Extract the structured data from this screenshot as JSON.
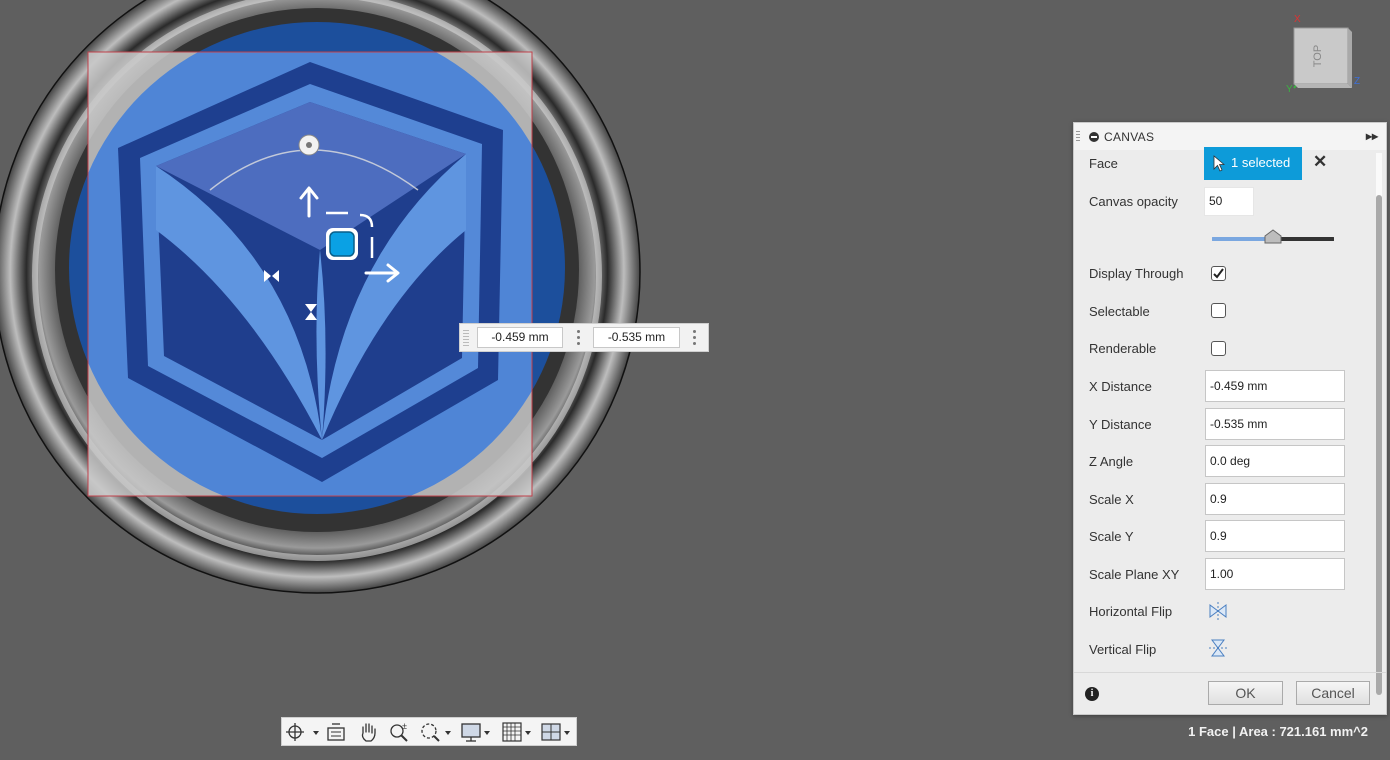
{
  "viewcube": {
    "face_label": "TOP",
    "axes": {
      "x": "X",
      "y": "Y",
      "z": "Z"
    }
  },
  "floating_inputs": {
    "x_value": "-0.459 mm",
    "y_value": "-0.535 mm"
  },
  "dialog": {
    "title": "CANVAS",
    "face": {
      "label": "Face",
      "selection_label": "1 selected",
      "clear_symbol": "✕"
    },
    "canvas_opacity": {
      "label": "Canvas opacity",
      "value": "50",
      "slider_fraction": 0.5
    },
    "display_through": {
      "label": "Display Through",
      "checked": true
    },
    "selectable": {
      "label": "Selectable",
      "checked": false
    },
    "renderable": {
      "label": "Renderable",
      "checked": false
    },
    "x_distance": {
      "label": "X Distance",
      "value": "-0.459 mm"
    },
    "y_distance": {
      "label": "Y Distance",
      "value": "-0.535 mm"
    },
    "z_angle": {
      "label": "Z Angle",
      "value": "0.0 deg"
    },
    "scale_x": {
      "label": "Scale X",
      "value": "0.9"
    },
    "scale_y": {
      "label": "Scale Y",
      "value": "0.9"
    },
    "scale_plane_xy": {
      "label": "Scale Plane XY",
      "value": "1.00"
    },
    "horizontal_flip": {
      "label": "Horizontal Flip"
    },
    "vertical_flip": {
      "label": "Vertical Flip"
    },
    "ok_label": "OK",
    "cancel_label": "Cancel"
  },
  "toolbar": {
    "icons": [
      "orbit-icon",
      "look-at-icon",
      "pan-icon",
      "zoom-icon",
      "fit-icon",
      "display-settings-icon",
      "grid-icon",
      "viewports-icon"
    ]
  },
  "status": {
    "text": "1 Face | Area : 721.161 mm^2"
  },
  "colors": {
    "viewport_bg": "#5f5f5f",
    "canvas_blue": "#4a7ed0",
    "logo_dark": "#1e3f8f",
    "accent": "#0d9bd9",
    "selection_outline": "#d0404a"
  }
}
